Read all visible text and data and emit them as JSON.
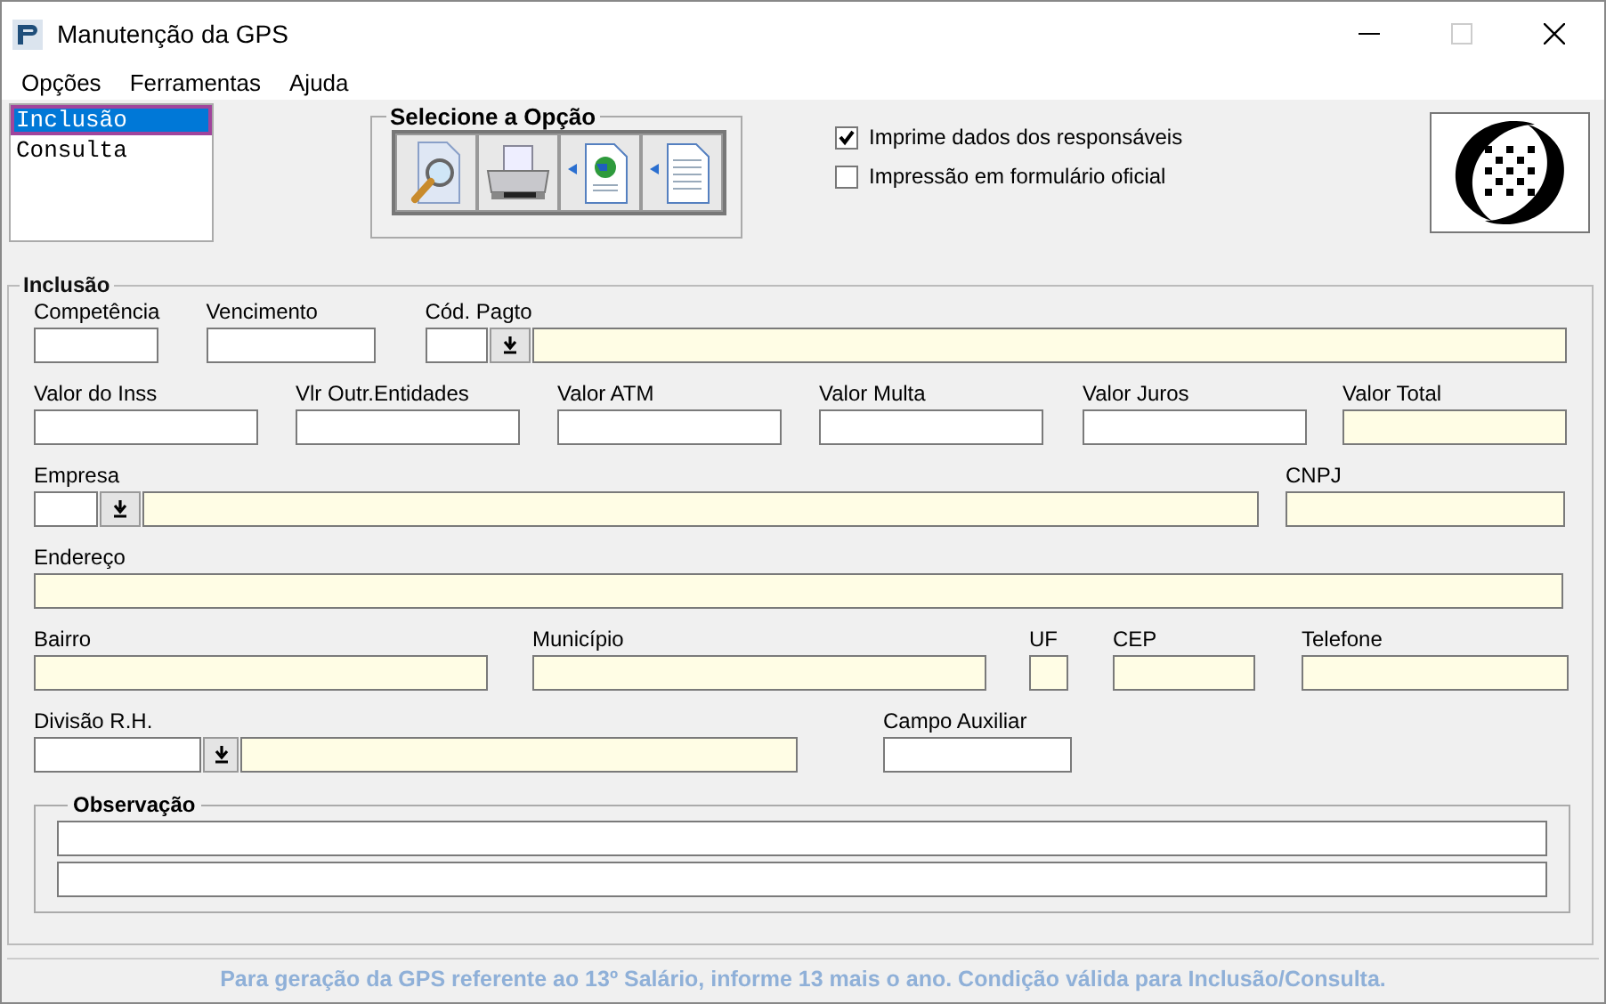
{
  "window": {
    "title": "Manutenção da GPS"
  },
  "menu": [
    "Opções",
    "Ferramentas",
    "Ajuda"
  ],
  "mode_list": [
    {
      "label": "Inclusão",
      "selected": true
    },
    {
      "label": "Consulta",
      "selected": false
    }
  ],
  "options_group": {
    "title": "Selecione a Opção",
    "buttons": [
      {
        "kind": "preview"
      },
      {
        "kind": "print"
      },
      {
        "kind": "web"
      },
      {
        "kind": "document"
      }
    ]
  },
  "checkboxes": [
    {
      "label": "Imprime dados dos responsáveis",
      "checked": true
    },
    {
      "label": "Impressão em formulário oficial",
      "checked": false
    }
  ],
  "form": {
    "title": "Inclusão",
    "lines": [
      {
        "fields": [
          {
            "label": "Competência",
            "kind": "text"
          },
          {
            "label": "Vencimento",
            "kind": "text"
          },
          {
            "label": "Cód. Pagto",
            "kind": "lookup"
          }
        ]
      },
      {
        "fields": [
          {
            "label": "Valor do Inss",
            "kind": "text"
          },
          {
            "label": "Vlr Outr.Entidades",
            "kind": "text"
          },
          {
            "label": "Valor ATM",
            "kind": "text"
          },
          {
            "label": "Valor Multa",
            "kind": "text"
          },
          {
            "label": "Valor Juros",
            "kind": "text"
          },
          {
            "label": "Valor Total",
            "kind": "readonly"
          }
        ]
      },
      {
        "fields": [
          {
            "label": "Empresa",
            "kind": "lookup"
          },
          {
            "label": "CNPJ",
            "kind": "readonly"
          }
        ]
      },
      {
        "fields": [
          {
            "label": "Endereço",
            "kind": "readonly"
          }
        ]
      },
      {
        "fields": [
          {
            "label": "Bairro",
            "kind": "readonly"
          },
          {
            "label": "Município",
            "kind": "readonly"
          },
          {
            "label": "UF",
            "kind": "readonly"
          },
          {
            "label": "CEP",
            "kind": "readonly"
          },
          {
            "label": "Telefone",
            "kind": "readonly"
          }
        ]
      },
      {
        "fields": [
          {
            "label": "Divisão R.H.",
            "kind": "lookup"
          },
          {
            "label": "Campo Auxiliar",
            "kind": "text"
          }
        ]
      }
    ],
    "observation": {
      "title": "Observação"
    }
  },
  "footer_note": "Para geração da GPS referente ao 13º Salário, informe 13 mais o ano. Condição válida para Inclusão/Consulta."
}
